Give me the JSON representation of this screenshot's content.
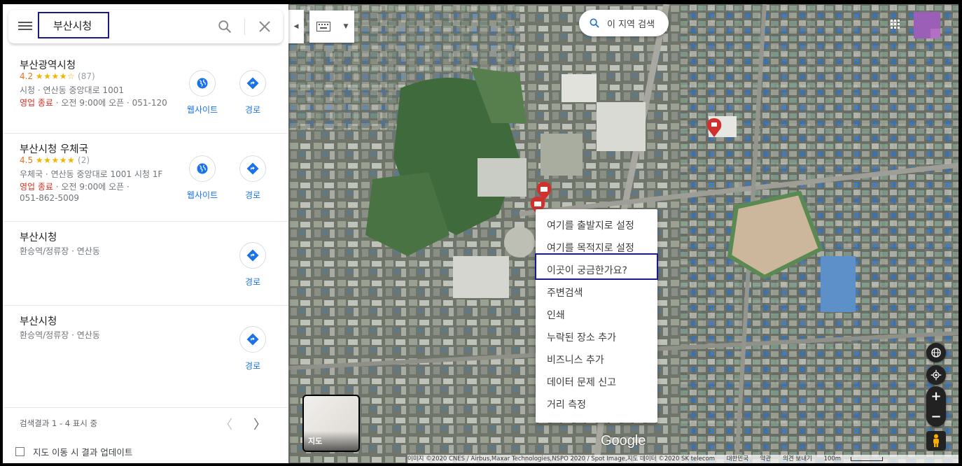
{
  "search": {
    "value": "부산시청"
  },
  "results": [
    {
      "title": "부산광역시청",
      "rating": "4.2",
      "stars": "★★★★☆",
      "reviews": "(87)",
      "line1": "시청 · 연산동 중앙대로 1001",
      "status": "영업 종료",
      "line2": " · 오전 9:00에 오픈 · 051-120",
      "website_label": "웹사이트",
      "route_label": "경로"
    },
    {
      "title": "부산시청 우체국",
      "rating": "4.5",
      "stars": "★★★★★",
      "reviews": "(2)",
      "line1": "우체국 · 연산동 중앙대로 1001 시청 1F",
      "status": "영업 종료",
      "line2": " · 오전 9:00에 오픈 ·",
      "line3": "051-862-5009",
      "website_label": "웹사이트",
      "route_label": "경로"
    },
    {
      "title": "부산시청",
      "line1": "환승역/정류장 · 연산동",
      "route_label": "경로"
    },
    {
      "title": "부산시청",
      "line1": "환승역/정류장 · 연산동",
      "route_label": "경로"
    }
  ],
  "pager": {
    "text": "검색결과 1 - 4 표시 중",
    "prev": "〈",
    "next": "〉"
  },
  "update_checkbox": {
    "label": "지도 이동 시 결과 업데이트",
    "checked": false
  },
  "map": {
    "area_search_label": "이 지역 검색",
    "context_menu": [
      "여기를 출발지로 설정",
      "여기를 목적지로 설정",
      "이곳이 궁금한가요?",
      "주변검색",
      "인쇄",
      "누락된 장소 추가",
      "비즈니스 추가",
      "데이터 문제 신고",
      "거리 측정"
    ],
    "layer_label": "지도",
    "logo": "Google",
    "attribution": {
      "imagery": "이미지 ©2020 CNES / Airbus,Maxar Technologies,NSPO 2020 / Spot Image,지도 데이터 ©2020 SK telecom",
      "country": "대한민국",
      "terms": "약관",
      "feedback": "의견 보내기",
      "scale": "100m"
    }
  },
  "colors": {
    "accent_blue": "#1a73e8",
    "closed_red": "#d93025",
    "rating_orange": "#e7711b",
    "highlight_box": "#1a1a8c"
  },
  "icons": [
    "menu-icon",
    "search-icon",
    "close-icon",
    "globe-icon",
    "directions-icon",
    "keyboard-icon",
    "apps-grid-icon",
    "layers-globe-icon",
    "my-location-icon",
    "pegman-icon"
  ]
}
